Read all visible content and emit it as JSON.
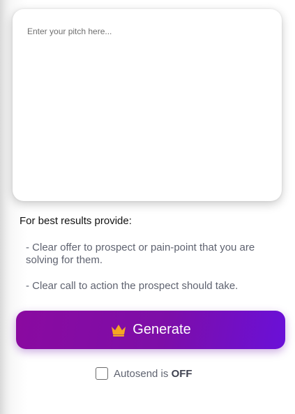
{
  "pitch": {
    "placeholder": "Enter your pitch here...",
    "value": ""
  },
  "tips": {
    "title": "For best results provide:",
    "items": [
      "- Clear offer to prospect or pain-point that you are solving for them.",
      "- Clear call to action the prospect should take."
    ]
  },
  "generate": {
    "label": "Generate",
    "icon": "crown-icon"
  },
  "autosend": {
    "label": "Autosend is",
    "state": "OFF",
    "checked": false
  },
  "colors": {
    "button_gradient_start": "#8a0aa0",
    "button_gradient_end": "#6a10d8",
    "crown": "#f5a623",
    "muted_text": "#5f6370"
  }
}
